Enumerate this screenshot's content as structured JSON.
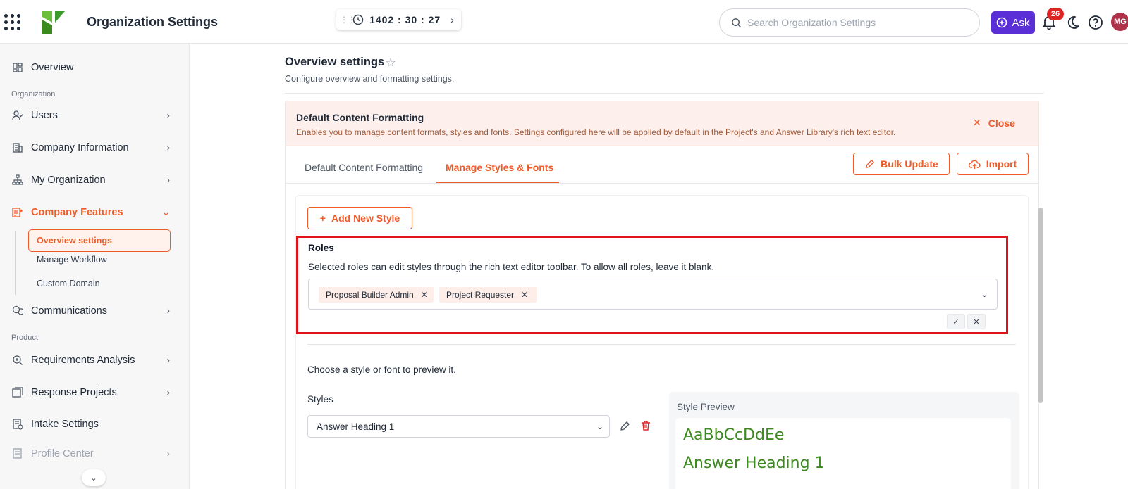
{
  "header": {
    "title": "Organization Settings",
    "timer": "1402 : 30 : 27",
    "search_placeholder": "Search Organization Settings",
    "ask_label": "Ask",
    "notification_count": "26",
    "avatar_initials": "MG",
    "colors": {
      "ask": "#5b2fd6",
      "badge": "#dc2626",
      "avatar": "#b0324a"
    }
  },
  "sidebar": {
    "overview": "Overview",
    "section_org": "Organization",
    "users": "Users",
    "company_info": "Company Information",
    "my_org": "My Organization",
    "company_features": "Company Features",
    "sub": {
      "overview_settings": "Overview settings",
      "manage_workflow": "Manage Workflow",
      "custom_domain": "Custom Domain"
    },
    "communications": "Communications",
    "section_product": "Product",
    "requirements": "Requirements Analysis",
    "response_projects": "Response Projects",
    "intake": "Intake Settings",
    "profile_center": "Profile Center",
    "accent": "#f05a28"
  },
  "main": {
    "title": "Overview settings",
    "subtitle": "Configure overview and formatting settings.",
    "banner": {
      "title": "Default Content Formatting",
      "description": "Enables you to manage content formats, styles and fonts. Settings configured here will be applied by default in the Project's and Answer Library's rich text editor.",
      "close": "Close"
    },
    "tabs": [
      "Default Content Formatting",
      "Manage Styles & Fonts"
    ],
    "bulk_update": "Bulk Update",
    "import": "Import",
    "add_new_style": "Add New Style",
    "roles": {
      "title": "Roles",
      "description": "Selected roles can edit styles through the rich text editor toolbar. To allow all roles, leave it blank.",
      "selected": [
        "Proposal Builder Admin",
        "Project Requester"
      ]
    },
    "choose_text": "Choose a style or font to preview it.",
    "styles_label": "Styles",
    "styles_value": "Answer Heading 1",
    "preview_label": "Style Preview",
    "preview_sample": "AaBbCcDdEe",
    "preview_name": "Answer Heading 1",
    "preview_color": "#3a8a1e"
  }
}
